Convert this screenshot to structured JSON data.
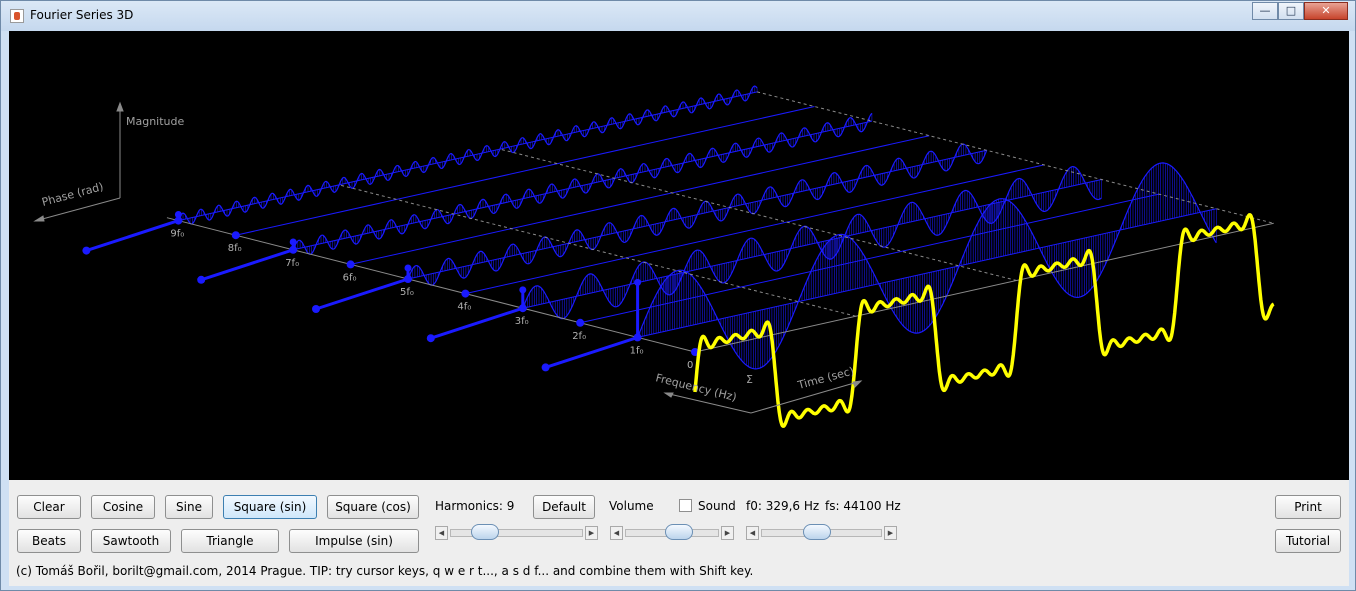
{
  "window": {
    "title": "Fourier Series 3D",
    "controls": [
      "minimize-icon",
      "maximize-icon",
      "close-icon"
    ]
  },
  "plot": {
    "axes": {
      "magnitude": "Magnitude",
      "phase": "Phase (rad)",
      "frequency": "Frequency (Hz)",
      "time": "Time (sec)"
    },
    "harmonic_labels": [
      "9f₀",
      "8f₀",
      "7f₀",
      "6f₀",
      "5f₀",
      "4f₀",
      "3f₀",
      "2f₀",
      "1f₀",
      "0"
    ],
    "sum_label": "Σ",
    "colors": {
      "background": "#000000",
      "harmonics": "#1a1aff",
      "sum": "#ffff00",
      "axes": "#8a8a8a"
    }
  },
  "controls": {
    "clear": "Clear",
    "cosine": "Cosine",
    "sine": "Sine",
    "square_sin": "Square (sin)",
    "square_cos": "Square (cos)",
    "beats": "Beats",
    "sawtooth": "Sawtooth",
    "triangle": "Triangle",
    "impulse_sin": "Impulse (sin)",
    "harmonics": "Harmonics: 9",
    "default": "Default",
    "volume": "Volume",
    "sound": "Sound",
    "f0": "f0: 329,6 Hz",
    "fs": "fs: 44100 Hz",
    "print": "Print",
    "tutorial": "Tutorial",
    "harmonics_slider": 0.2,
    "volume_slider": 0.6,
    "f0_slider": 0.45
  },
  "status": "(c) Tomáš Bořil, borilt@gmail.com, 2014 Prague. TIP: try cursor keys, q w e r t..., a s d f... and combine them with Shift key."
}
